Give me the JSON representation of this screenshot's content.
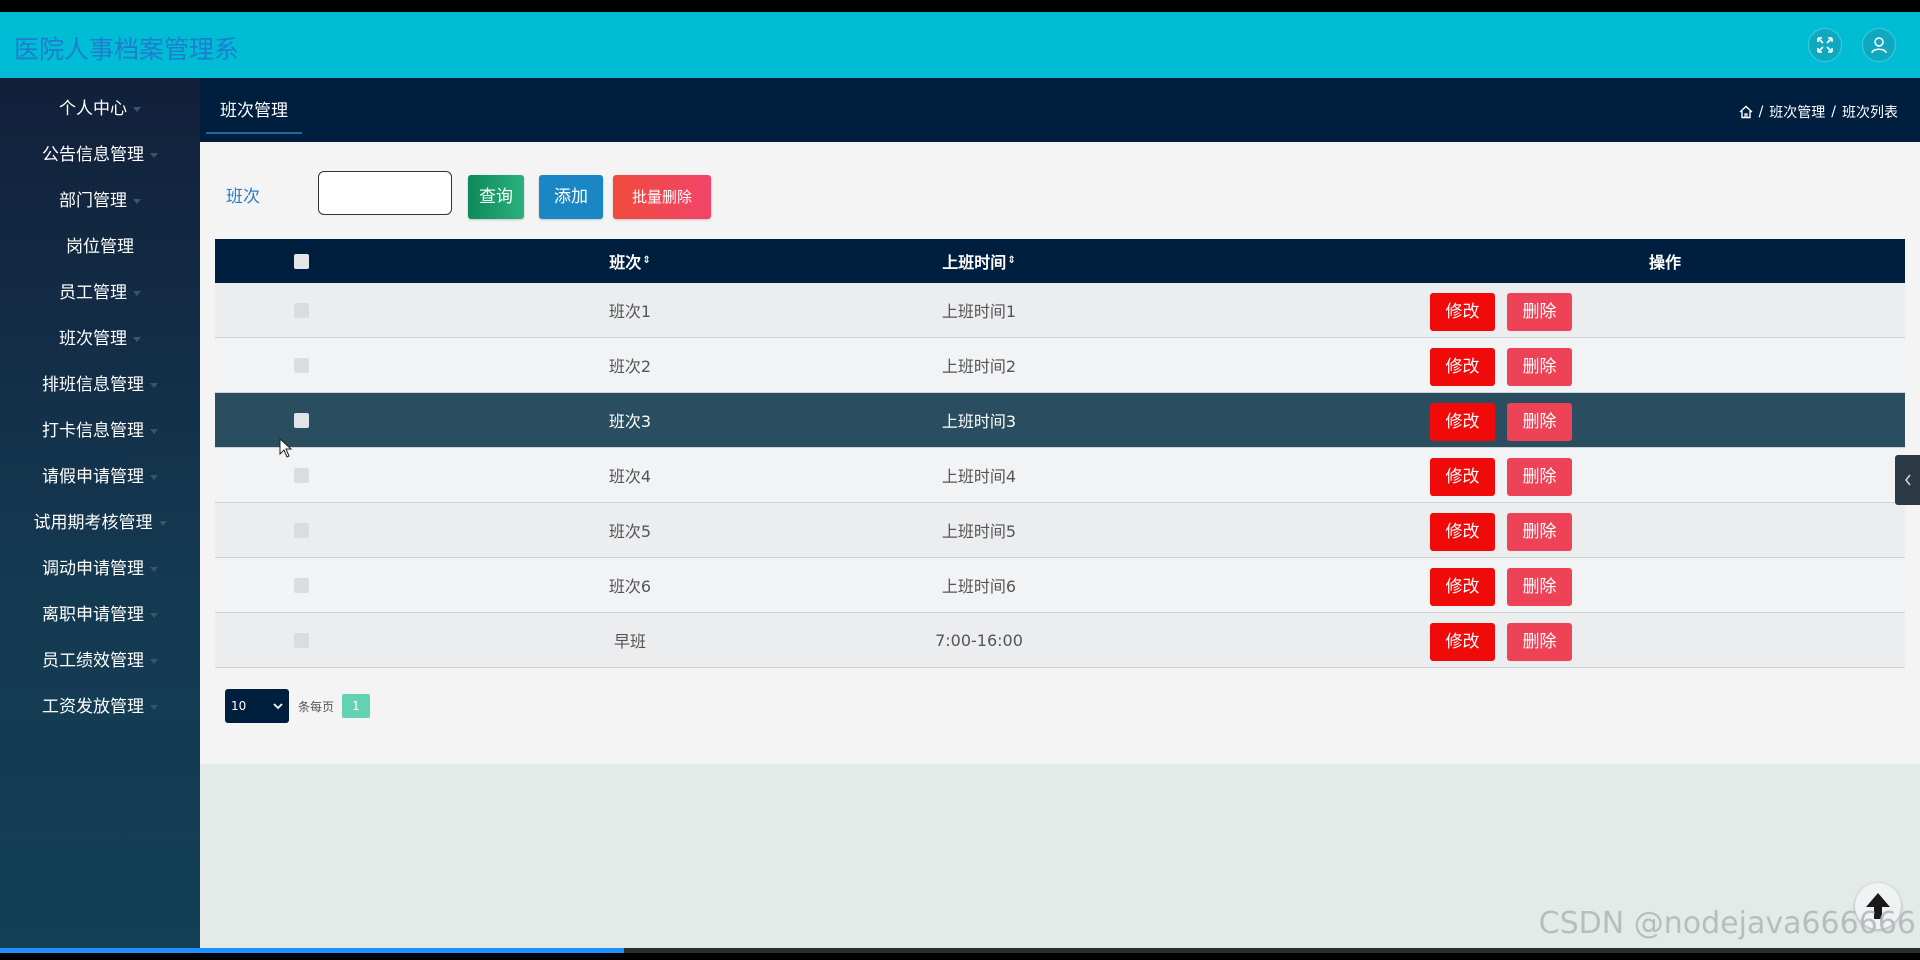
{
  "app": {
    "title": "医院人事档案管理系"
  },
  "sidebar": {
    "items": [
      {
        "label": "个人中心",
        "caret": true
      },
      {
        "label": "公告信息管理",
        "caret": true
      },
      {
        "label": "部门管理",
        "caret": true
      },
      {
        "label": "岗位管理",
        "caret": false
      },
      {
        "label": "员工管理",
        "caret": true
      },
      {
        "label": "班次管理",
        "caret": true
      },
      {
        "label": "排班信息管理",
        "caret": true
      },
      {
        "label": "打卡信息管理",
        "caret": true
      },
      {
        "label": "请假申请管理",
        "caret": true
      },
      {
        "label": "试用期考核管理",
        "caret": true
      },
      {
        "label": "调动申请管理",
        "caret": true
      },
      {
        "label": "离职申请管理",
        "caret": true
      },
      {
        "label": "员工绩效管理",
        "caret": true
      },
      {
        "label": "工资发放管理",
        "caret": true
      }
    ]
  },
  "header": {
    "tab": "班次管理",
    "breadcrumb": {
      "sep": "/",
      "section": "班次管理",
      "page": "班次列表"
    }
  },
  "search": {
    "label": "班次",
    "value": "",
    "query_btn": "查询",
    "add_btn": "添加",
    "batch_delete_btn": "批量删除"
  },
  "table": {
    "columns": {
      "shift": "班次",
      "start_time": "上班时间",
      "action": "操作"
    },
    "sort_icon": "⇕",
    "edit_label": "修改",
    "delete_label": "删除",
    "rows": [
      {
        "shift": "班次1",
        "start_time": "上班时间1"
      },
      {
        "shift": "班次2",
        "start_time": "上班时间2"
      },
      {
        "shift": "班次3",
        "start_time": "上班时间3"
      },
      {
        "shift": "班次4",
        "start_time": "上班时间4"
      },
      {
        "shift": "班次5",
        "start_time": "上班时间5"
      },
      {
        "shift": "班次6",
        "start_time": "上班时间6"
      },
      {
        "shift": "早班",
        "start_time": "7:00-16:00"
      }
    ]
  },
  "pager": {
    "page_size": "10",
    "per_page_label": "条每页",
    "current_page": "1"
  },
  "watermark": "CSDN @nodejava666666",
  "video_progress": 0.325,
  "colors": {
    "topbar": "#00bcd4",
    "header": "#001f3f",
    "edit": "#f00a0a",
    "delete": "#ee4356",
    "query": "#1a9a6a",
    "add": "#1a86c4"
  }
}
